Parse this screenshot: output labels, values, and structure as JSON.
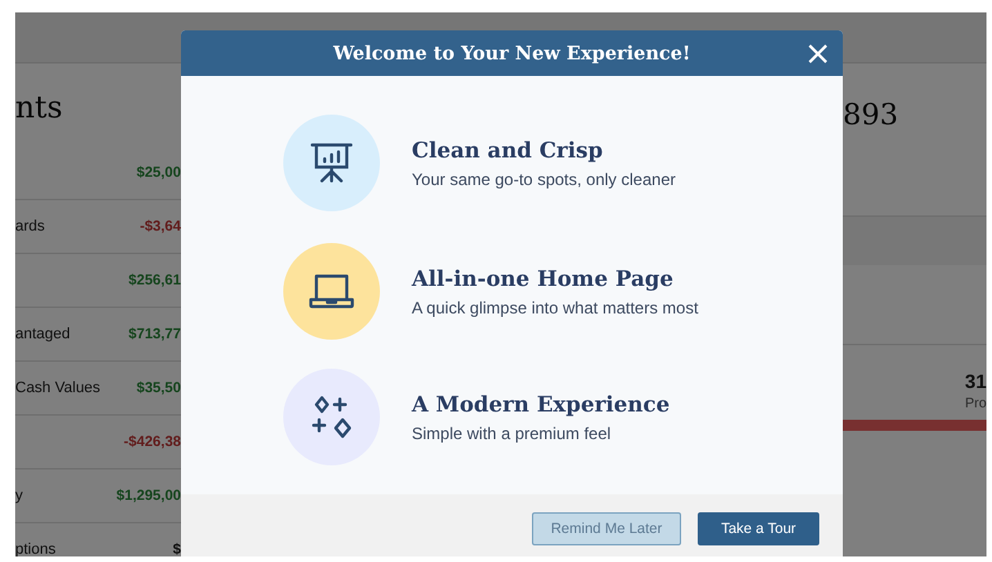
{
  "background_page": {
    "heading": "nts",
    "accounts": [
      {
        "value": "$25,00",
        "kind": "gain"
      },
      {
        "label": "ards",
        "value": "-$3,64",
        "kind": "loss"
      },
      {
        "value": "$256,61",
        "kind": "gain"
      },
      {
        "label": "antaged",
        "value": "$713,77",
        "kind": "gain"
      },
      {
        "label": "Cash Values",
        "value": "$35,50",
        "kind": "gain"
      },
      {
        "value": "-$426,38",
        "kind": "loss"
      },
      {
        "label": "y",
        "value": "$1,295,00",
        "kind": "gain"
      },
      {
        "label": "ptions",
        "value": "$",
        "kind": "neutral"
      }
    ],
    "total": "893",
    "stat": {
      "value": "31",
      "label": "Pro"
    }
  },
  "dialog": {
    "title": "Welcome to Your New Experience!",
    "features": [
      {
        "kind": "presentation",
        "color": "#d8eefc",
        "title": "Clean and Crisp",
        "text": "Your same go-to spots, only cleaner"
      },
      {
        "kind": "laptop",
        "color": "#fde39c",
        "title": "All-in-one Home Page",
        "text": "A quick glimpse into what matters most"
      },
      {
        "kind": "sparkles",
        "color": "#e8eafd",
        "title": "A Modern Experience",
        "text": "Simple with a premium feel"
      }
    ],
    "buttons": [
      {
        "label": "Remind Me Later",
        "kind": "secondary"
      },
      {
        "label": "Take a Tour",
        "kind": "primary"
      }
    ]
  }
}
